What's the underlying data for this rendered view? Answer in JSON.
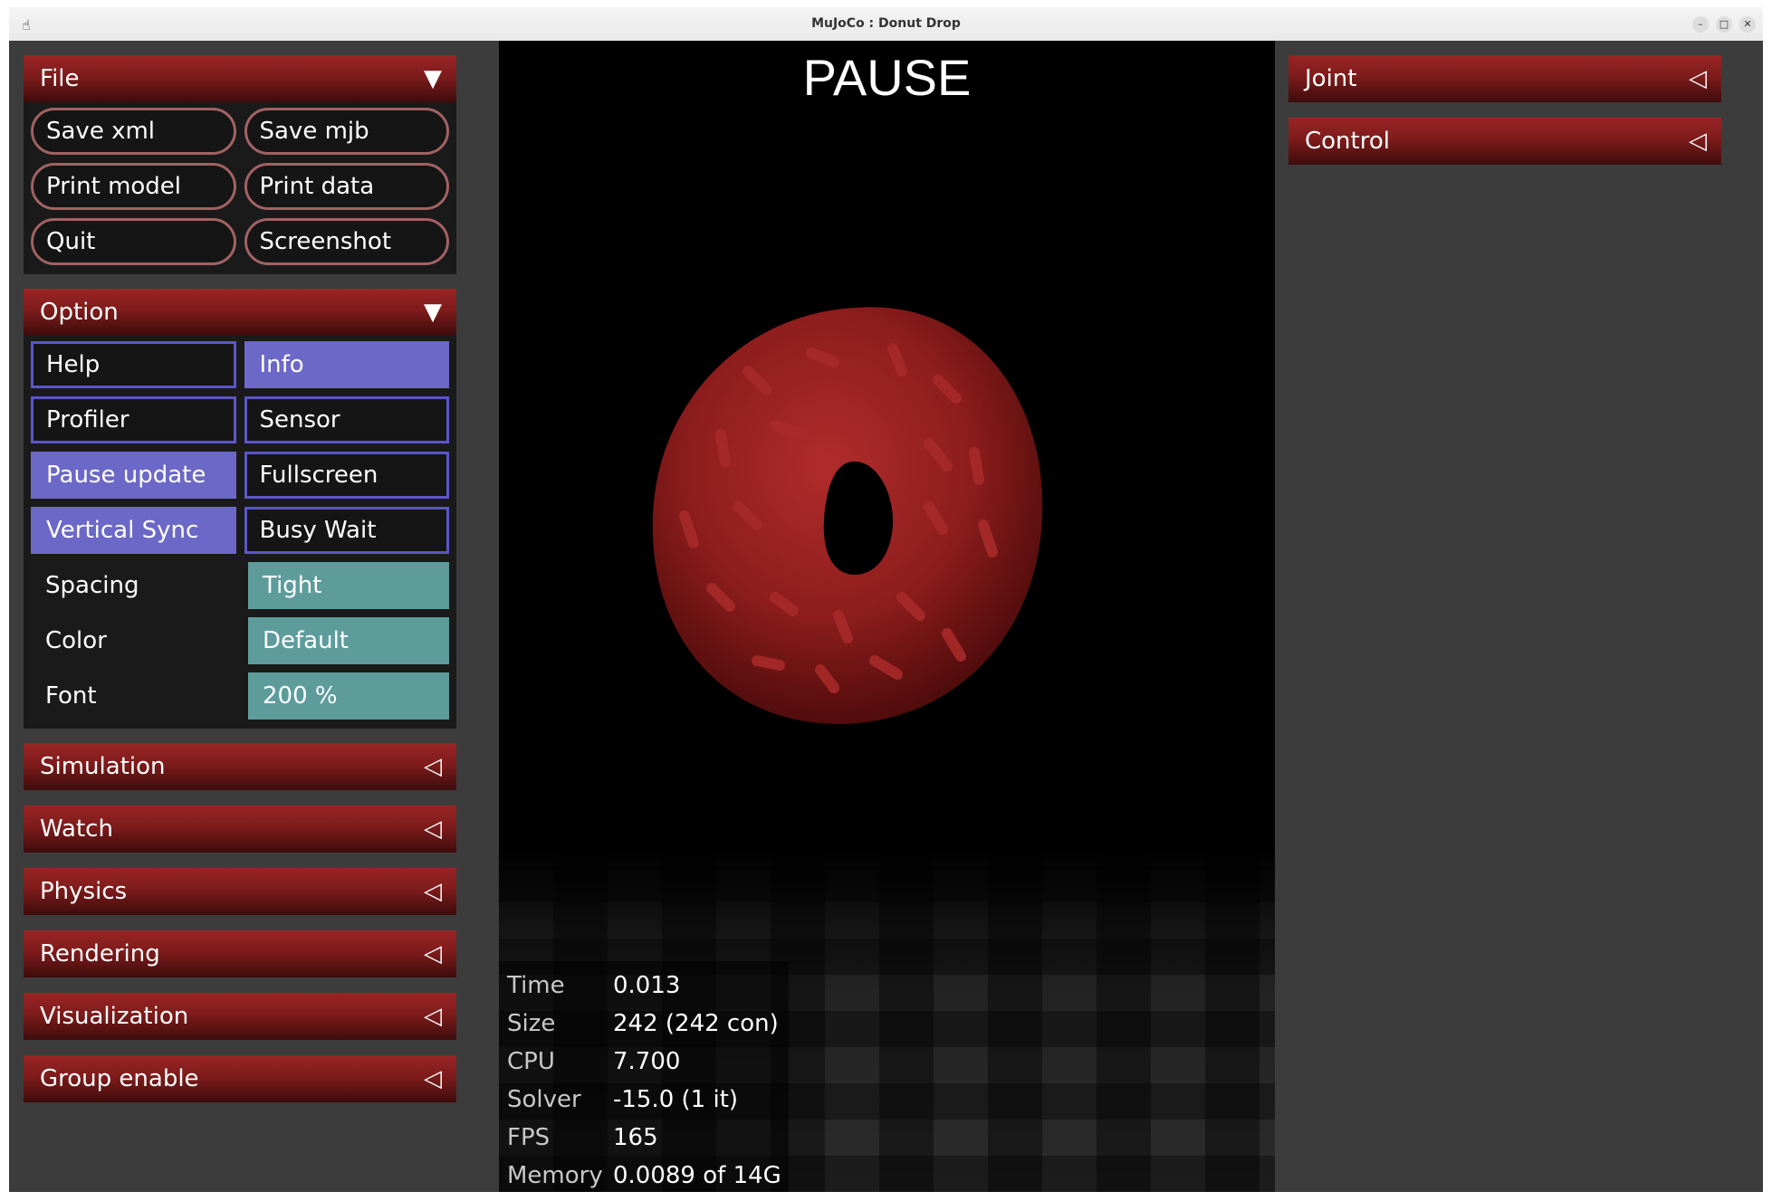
{
  "window": {
    "title": "MuJoCo : Donut Drop"
  },
  "viewport": {
    "status": "PAUSE"
  },
  "left_panel": {
    "file": {
      "header": "File",
      "buttons": [
        "Save xml",
        "Save mjb",
        "Print model",
        "Print data",
        "Quit",
        "Screenshot"
      ]
    },
    "option": {
      "header": "Option",
      "toggles": [
        {
          "label": "Help",
          "on": false
        },
        {
          "label": "Info",
          "on": true
        },
        {
          "label": "Profiler",
          "on": false
        },
        {
          "label": "Sensor",
          "on": false
        },
        {
          "label": "Pause update",
          "on": true
        },
        {
          "label": "Fullscreen",
          "on": false
        },
        {
          "label": "Vertical Sync",
          "on": true
        },
        {
          "label": "Busy Wait",
          "on": false
        }
      ],
      "selects": [
        {
          "label": "Spacing",
          "value": "Tight"
        },
        {
          "label": "Color",
          "value": "Default"
        },
        {
          "label": "Font",
          "value": "200 %"
        }
      ]
    },
    "collapsed_sections": [
      "Simulation",
      "Watch",
      "Physics",
      "Rendering",
      "Visualization",
      "Group enable"
    ]
  },
  "right_panel": {
    "collapsed_sections": [
      "Joint",
      "Control"
    ]
  },
  "info_overlay": [
    {
      "key": "Time",
      "value": "0.013"
    },
    {
      "key": "Size",
      "value": "242  (242 con)"
    },
    {
      "key": "CPU",
      "value": "7.700"
    },
    {
      "key": "Solver",
      "value": "-15.0  (1 it)"
    },
    {
      "key": "FPS",
      "value": "165"
    },
    {
      "key": "Memory",
      "value": "0.0089 of 14G"
    }
  ],
  "colors": {
    "header_red": "#9a2525",
    "toggle_on": "#6c68c8",
    "select_teal": "#5e9c9c",
    "donut": "#8b1a1a"
  },
  "icons": {
    "expanded": "triangle-down-icon",
    "collapsed": "triangle-left-icon"
  }
}
